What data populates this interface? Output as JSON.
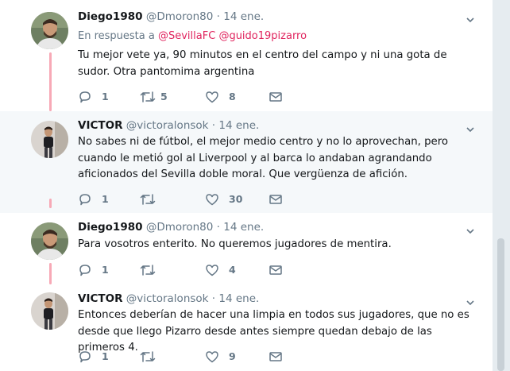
{
  "colors": {
    "accent": "#e0245e",
    "thread": "#f7a9b6",
    "muted": "#657786",
    "highlight_bg": "#f5f8fa"
  },
  "tweets": [
    {
      "name": "Diego1980",
      "handle": "@Dmoron80",
      "sep": "·",
      "date": "14 ene.",
      "reply_prefix": "En respuesta a",
      "reply_mentions": [
        "@SevillaFC",
        "@guido19pizarro"
      ],
      "text": "Tu mejor vete ya, 90 minutos en el centro del campo y ni una gota de sudor. Otra pantomima argentina",
      "replies": "1",
      "retweets": "5",
      "likes": "8"
    },
    {
      "name": "VICTOR",
      "handle": "@victoralonsok",
      "sep": "·",
      "date": "14 ene.",
      "text": "No sabes ni de fútbol, el mejor medio centro y no lo aprovechan, pero cuando le metió gol al Liverpool y al barca lo andaban agrandando aficionados del Sevilla doble moral. Que vergüenza de afición.",
      "replies": "1",
      "retweets": "",
      "likes": "30"
    },
    {
      "name": "Diego1980",
      "handle": "@Dmoron80",
      "sep": "·",
      "date": "14 ene.",
      "text": "Para vosotros enterito. No queremos jugadores de mentira.",
      "replies": "1",
      "retweets": "",
      "likes": "4"
    },
    {
      "name": "VICTOR",
      "handle": "@victoralonsok",
      "sep": "·",
      "date": "14 ene.",
      "text": "Entonces deberían de hacer una limpia en todos sus jugadores, que no es desde que llego Pizarro desde antes siempre quedan debajo de las primeros 4.",
      "replies": "1",
      "retweets": "",
      "likes": "9"
    }
  ],
  "icons": [
    "reply-icon",
    "retweet-icon",
    "like-icon",
    "direct-message-icon",
    "caret-down-icon",
    "avatar"
  ]
}
